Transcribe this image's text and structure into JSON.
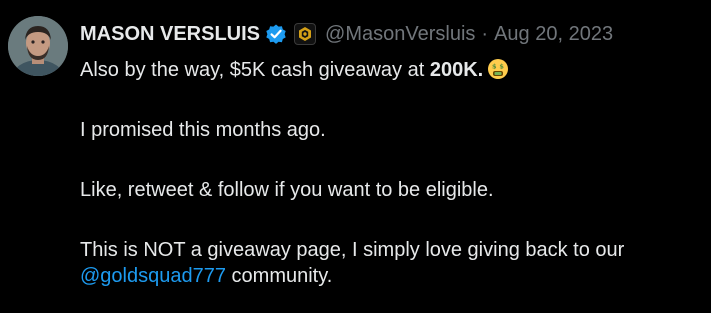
{
  "author": {
    "display_name": "MASON VERSLUIS",
    "handle": "@MasonVersluis",
    "separator": "·",
    "date": "Aug 20, 2023",
    "avatar_icon": "user-avatar",
    "verified_icon": "verified-badge-icon",
    "affiliate_icon": "affiliate-badge-icon"
  },
  "tweet": {
    "line1_prefix": "Also by the way, $5K cash giveaway at ",
    "line1_bold": "200K.",
    "line1_emoji": "money-mouth-face-icon",
    "line2": "I promised this months ago.",
    "line3": "Like, retweet & follow if you want to be eligible.",
    "line4": "This is NOT a giveaway page, I simply love giving back to our",
    "mention": "@goldsquad777",
    "line5_suffix": " community."
  },
  "colors": {
    "background": "#000000",
    "text": "#e7e9ea",
    "muted": "#71767b",
    "link": "#1d9bf0",
    "verified": "#1d9bf0"
  }
}
